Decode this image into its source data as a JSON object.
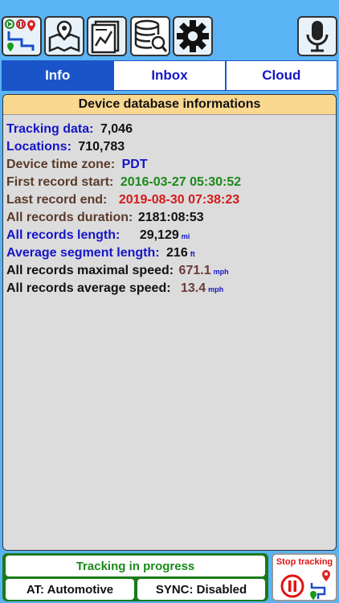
{
  "toolbar": {
    "buttons": [
      {
        "icon": "tracking-icon"
      },
      {
        "icon": "map-icon"
      },
      {
        "icon": "chart-report-icon"
      },
      {
        "icon": "database-search-icon"
      },
      {
        "icon": "settings-icon"
      },
      {
        "icon": "microphone-icon"
      }
    ]
  },
  "tabs": [
    {
      "label": "Info",
      "active": true
    },
    {
      "label": "Inbox",
      "active": false
    },
    {
      "label": "Cloud",
      "active": false
    }
  ],
  "panel": {
    "title": "Device database informations",
    "rows": [
      {
        "label": "Tracking data:",
        "value": "7,046",
        "unit": ""
      },
      {
        "label": "Locations:",
        "value": "710,783",
        "unit": ""
      },
      {
        "label": "Device time zone:",
        "value": "PDT",
        "unit": ""
      },
      {
        "label": "First record start:",
        "value": "2016-03-27 05:30:52",
        "unit": ""
      },
      {
        "label": "Last record end:",
        "value": "2019-08-30 07:38:23",
        "unit": ""
      },
      {
        "label": "All records duration:",
        "value": "2181:08:53",
        "unit": ""
      },
      {
        "label": "All records length:",
        "value": "29,129",
        "unit": "mi"
      },
      {
        "label": "Average segment length:",
        "value": "216",
        "unit": "ft"
      },
      {
        "label": "All records maximal speed:",
        "value": "671.1",
        "unit": "mph"
      },
      {
        "label": "All records average speed:",
        "value": "13.4",
        "unit": "mph"
      }
    ]
  },
  "status": {
    "tracking": "Tracking in progress",
    "mode": "AT: Automotive",
    "sync": "SYNC: Disabled"
  },
  "stop": {
    "label": "Stop tracking"
  },
  "colors": {
    "background": "#5ab3f5",
    "tab_active": "#1a54c9",
    "header": "#fbd890",
    "status_green": "#1a8a1a",
    "stop_red": "#e01414"
  }
}
